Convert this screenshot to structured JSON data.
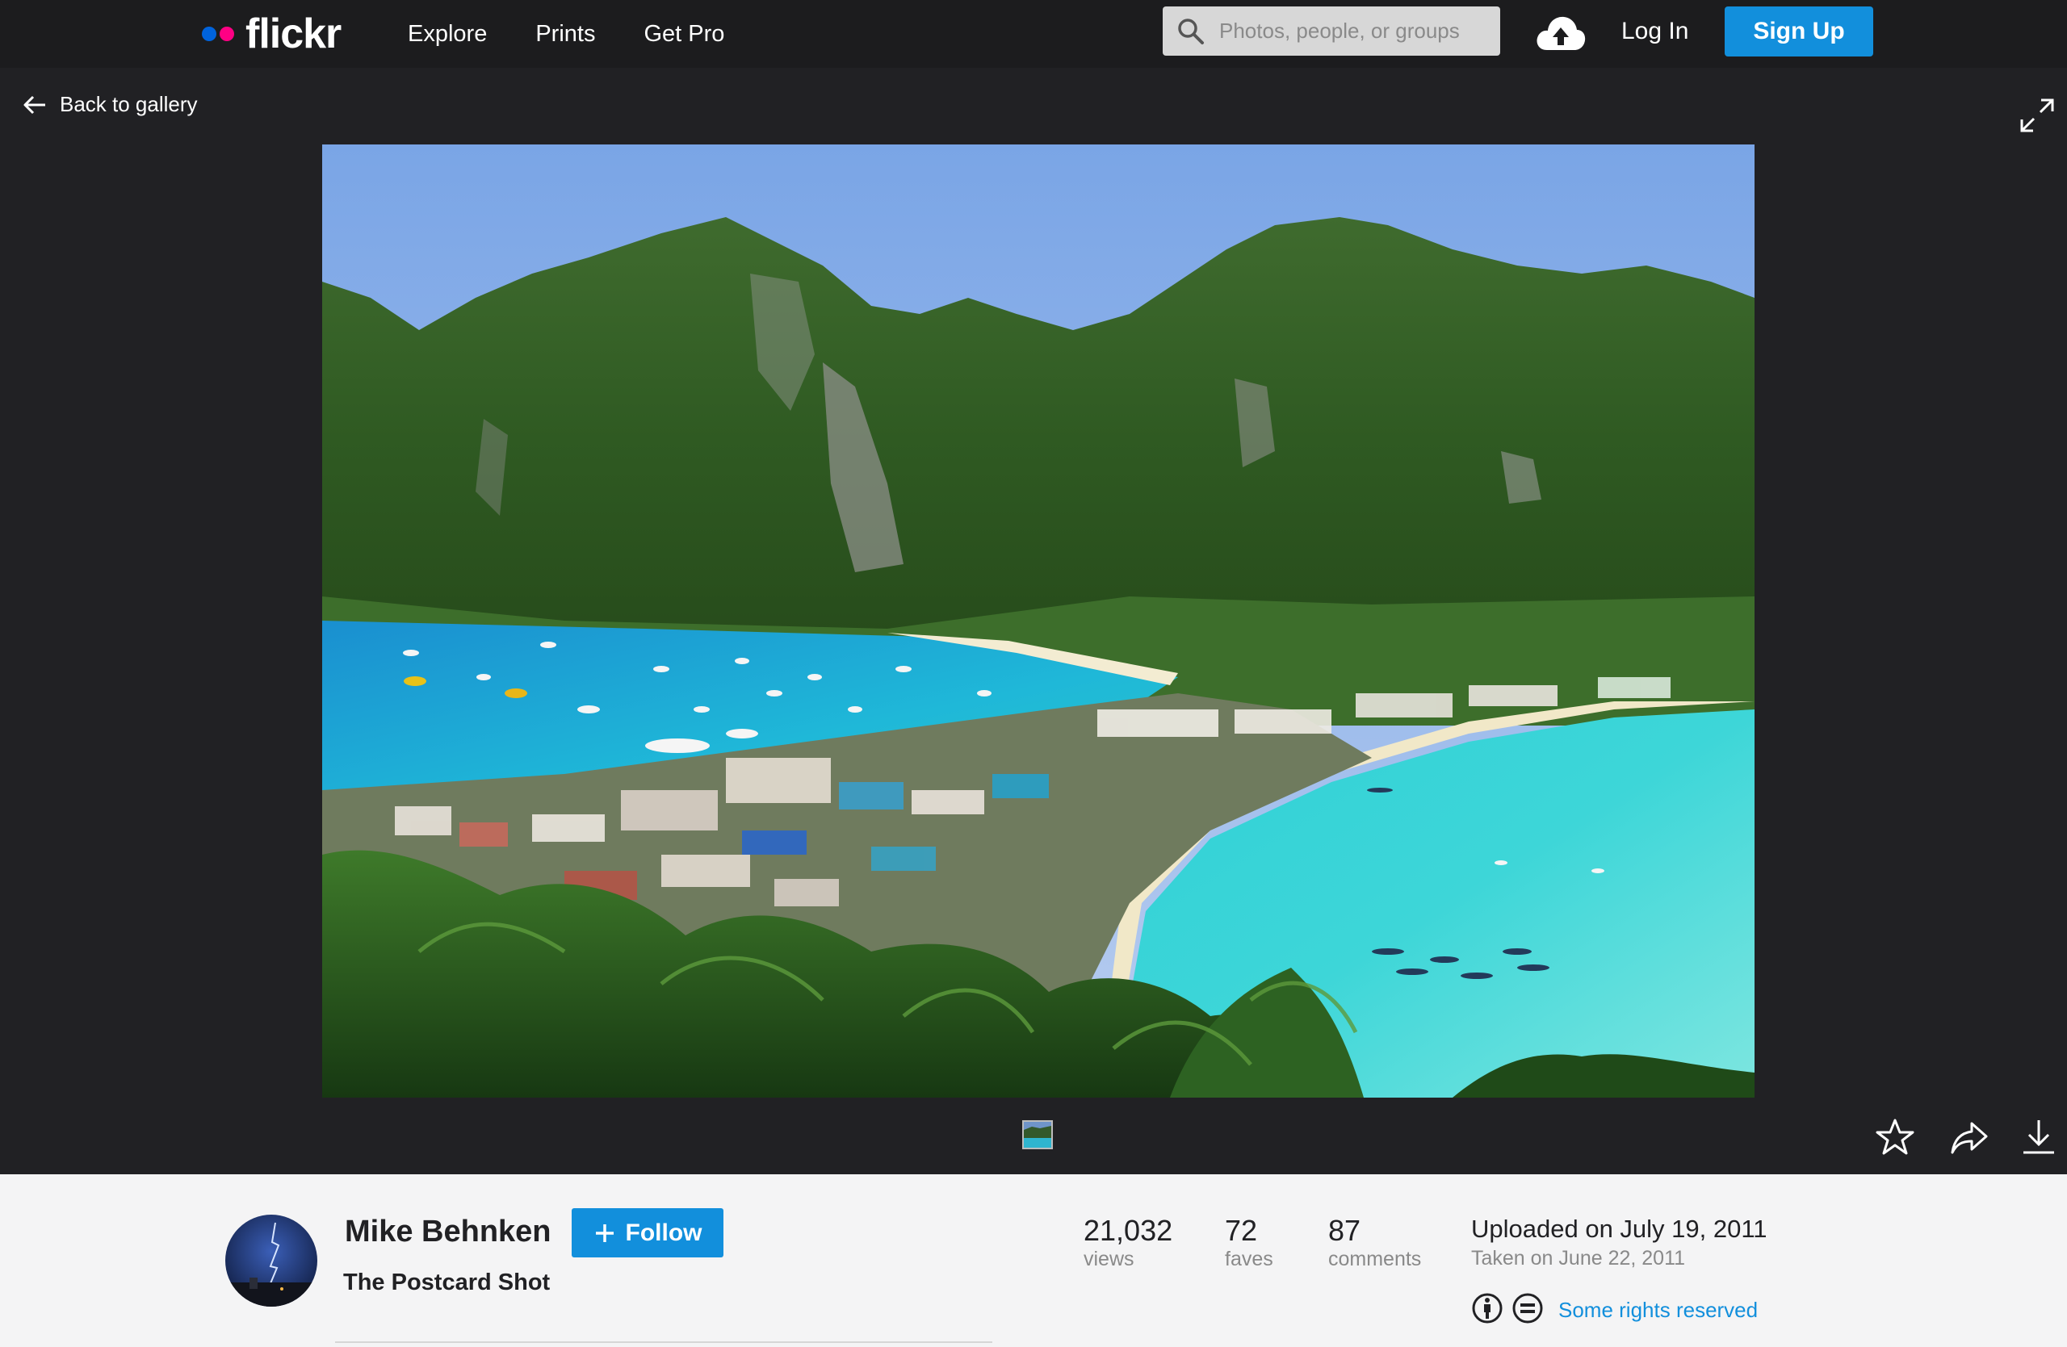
{
  "nav": {
    "logo_text": "flickr",
    "links": [
      "Explore",
      "Prints",
      "Get Pro"
    ],
    "search_placeholder": "Photos, people, or groups",
    "login": "Log In",
    "signup": "Sign Up"
  },
  "viewer": {
    "back_label": "Back to gallery"
  },
  "photo": {
    "author": "Mike Behnken",
    "follow_label": "Follow",
    "title": "The Postcard Shot",
    "stats": [
      {
        "value": "21,032",
        "label": "views"
      },
      {
        "value": "72",
        "label": "faves"
      },
      {
        "value": "87",
        "label": "comments"
      }
    ],
    "uploaded": "Uploaded on July 19, 2011",
    "taken": "Taken on June 22, 2011",
    "license": "Some rights reserved"
  },
  "colors": {
    "nav_bg": "#1c1c1e",
    "viewer_bg": "#212124",
    "accent": "#128fdc",
    "flickr_blue": "#0063dc",
    "flickr_pink": "#ff0084"
  }
}
